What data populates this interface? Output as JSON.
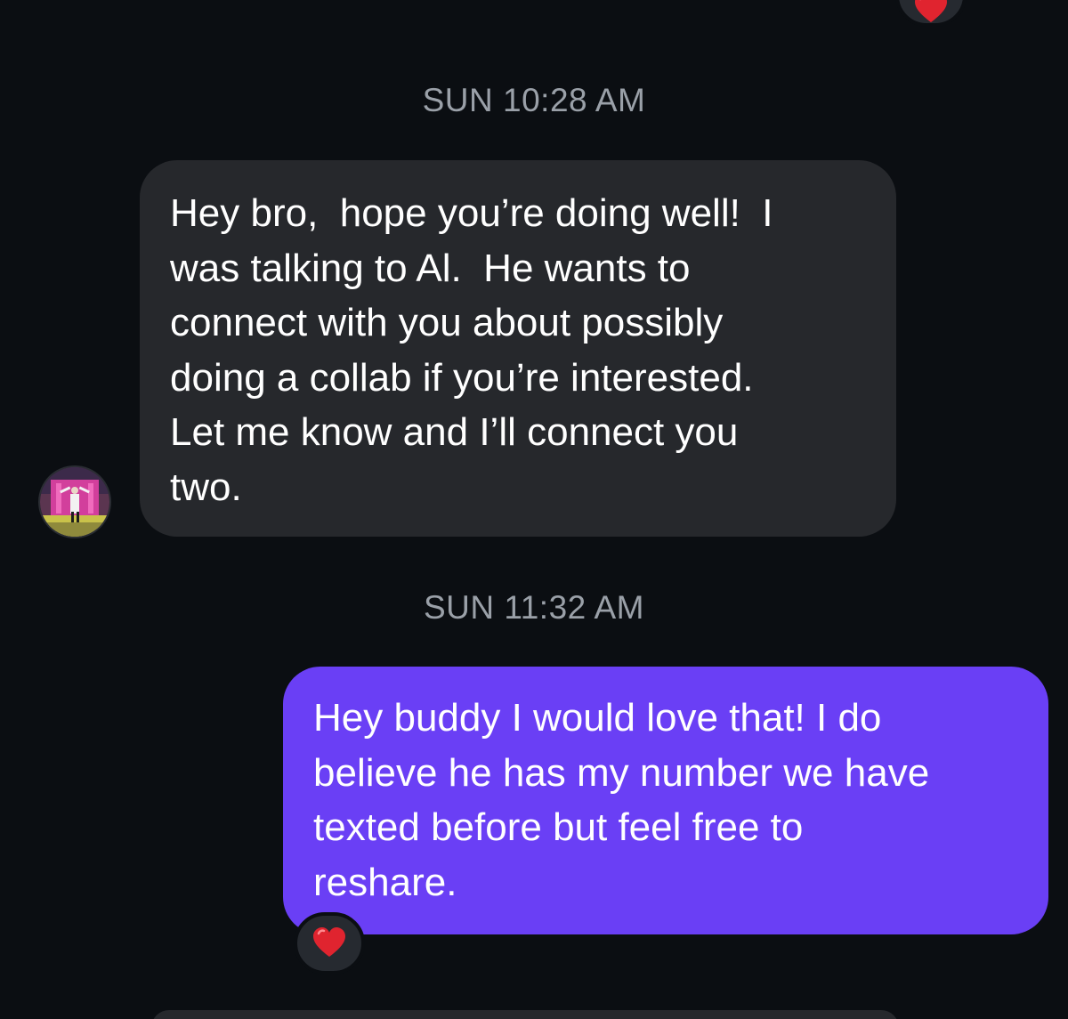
{
  "thread": {
    "reaction_emoji_name": "red-heart",
    "reaction_color": "#e0242f",
    "incoming_bubble_color": "#26282c",
    "outgoing_bubble_color": "#6a3ff5",
    "background_color": "#0b0e12",
    "messages": [
      {
        "timestamp": "SUN 10:28 AM",
        "direction": "incoming",
        "lines": [
          "Hey bro,  hope you’re doing well!  I",
          "was talking to Al.  He wants to",
          "connect with you about possibly",
          "doing a collab if you’re interested.",
          "Let me know and I’ll connect you",
          "two."
        ]
      },
      {
        "timestamp": "SUN 11:32 AM",
        "direction": "outgoing",
        "lines": [
          "Hey buddy I would love that! I do",
          "believe he has my number we have",
          "texted before but feel free to",
          "reshare."
        ],
        "reaction": "red-heart"
      }
    ]
  }
}
